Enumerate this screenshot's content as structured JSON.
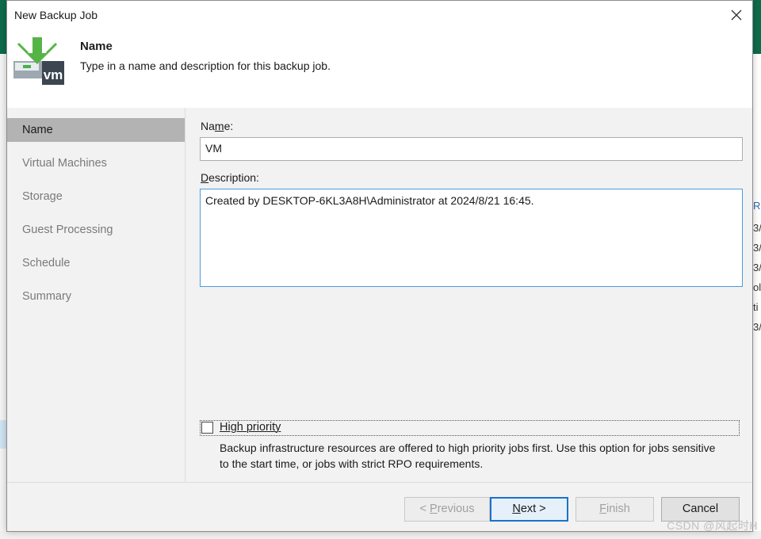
{
  "dialog": {
    "title": "New Backup Job",
    "header_title": "Name",
    "header_subtitle": "Type in a name and description for this backup job."
  },
  "sidebar": {
    "items": [
      {
        "label": "Name",
        "active": true
      },
      {
        "label": "Virtual Machines"
      },
      {
        "label": "Storage"
      },
      {
        "label": "Guest Processing"
      },
      {
        "label": "Schedule"
      },
      {
        "label": "Summary"
      }
    ]
  },
  "form": {
    "name_label_pre": "Na",
    "name_label_mn": "m",
    "name_label_post": "e:",
    "name_value": "VM",
    "description_label_pre": "",
    "description_label_d": "D",
    "description_label_post": "escription:",
    "description_value": "Created by DESKTOP-6KL3A8H\\Administrator at 2024/8/21 16:45.",
    "high_priority_label": "High priority",
    "high_priority_checked": false,
    "high_priority_hint": "Backup infrastructure resources are offered to high priority jobs first. Use this option for jobs sensitive to the start time, or jobs with strict RPO requirements."
  },
  "buttons": {
    "previous_pre": "< ",
    "previous_u": "P",
    "previous_post": "revious",
    "next_u": "N",
    "next_post": "ext >",
    "finish_u": "F",
    "finish_post": "inish",
    "cancel": "Cancel"
  },
  "background": {
    "right_text": [
      "Ru",
      "3/",
      "3/",
      "3/",
      "ol",
      "ti",
      "3/"
    ]
  },
  "watermark": "CSDN @风起时H",
  "colors": {
    "app_header": "#0d6b4a",
    "accent": "#1a73c8",
    "icon_green": "#4caf50"
  }
}
